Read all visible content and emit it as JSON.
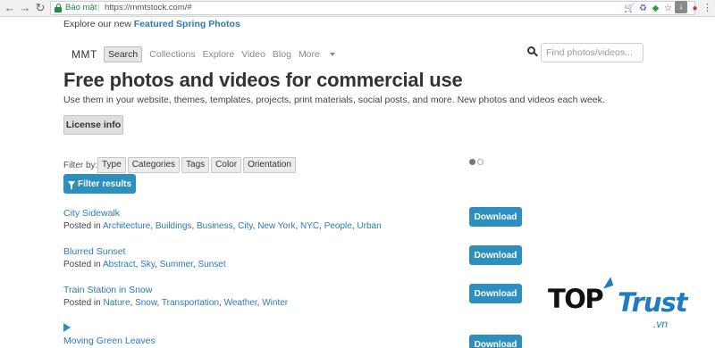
{
  "browser": {
    "secure_label": "Bảo mật",
    "url": "https://mmtstock.com/#",
    "back_icon": "back-arrow-icon",
    "forward_icon": "forward-arrow-icon",
    "reload_icon": "reload-icon"
  },
  "promo": {
    "text": "Explore our new",
    "link": "Featured Spring Photos"
  },
  "header": {
    "brand": "MMT",
    "nav": [
      "Search",
      "Collections",
      "Explore",
      "Video",
      "Blog",
      "More"
    ],
    "search_placeholder": "Find photos/videos..."
  },
  "hero": {
    "title": "Free photos and videos for commercial use",
    "subtitle": "Use them in your website, themes, templates, projects, print materials, social posts, and more. New photos and videos each week.",
    "license_button": "License info"
  },
  "filters": {
    "label": "Filter by:",
    "options": [
      "Type",
      "Categories",
      "Tags",
      "Color",
      "Orientation"
    ],
    "button": "Filter results"
  },
  "items": [
    {
      "title": "City Sidewalk",
      "posted_in": "Posted in",
      "tags": [
        "Architecture",
        "Buildings",
        "Business",
        "City",
        "New York",
        "NYC",
        "People",
        "Urban"
      ],
      "download": "Download"
    },
    {
      "title": "Blurred Sunset",
      "posted_in": "Posted in",
      "tags": [
        "Abstract",
        "Sky",
        "Summer",
        "Sunset"
      ],
      "download": "Download"
    },
    {
      "title": "Train Station in Snow",
      "posted_in": "Posted in",
      "tags": [
        "Nature",
        "Snow",
        "Transportation",
        "Weather",
        "Winter"
      ],
      "download": "Download"
    },
    {
      "title": "Moving Green Leaves",
      "download": "Download"
    }
  ],
  "watermark": {
    "part1": "TOP",
    "part2": "Trust",
    "domain": ".vn"
  },
  "colors": {
    "accent": "#2d8fbf",
    "link": "#2a7ab8",
    "secure": "#1e8e3e"
  }
}
